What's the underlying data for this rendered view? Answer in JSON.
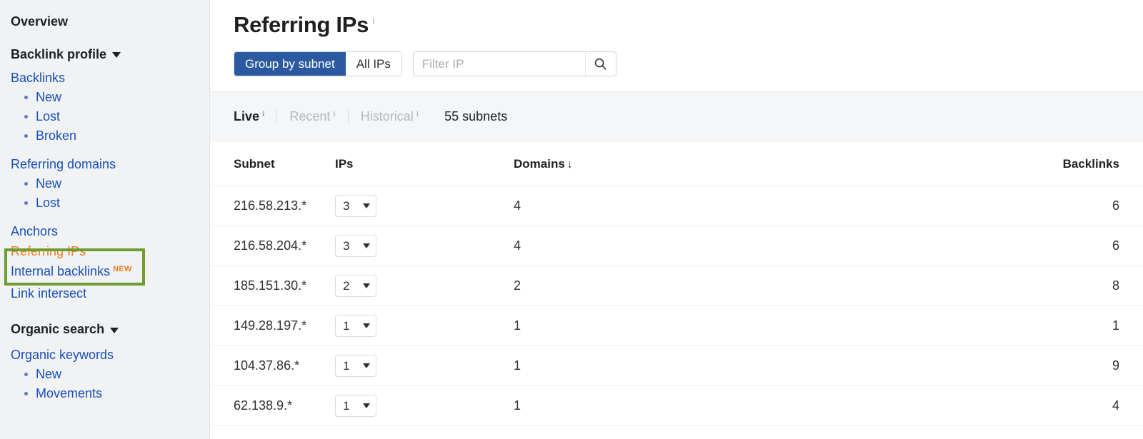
{
  "theme": {
    "accent_blue": "#2c5aa0",
    "link_blue": "#1a4fba",
    "active_orange": "#ef7d22",
    "highlight_green": "#6f9c2f",
    "sidebar_bg": "#f1f2f3",
    "strip_bg": "#f5f6f7"
  },
  "sidebar": {
    "overview_label": "Overview",
    "groups": [
      {
        "title": "Backlink profile",
        "caret": "chevron-down-icon",
        "items": [
          {
            "label": "Backlinks",
            "type": "link",
            "active": false
          },
          {
            "label": "New",
            "type": "sub",
            "active": false
          },
          {
            "label": "Lost",
            "type": "sub",
            "active": false
          },
          {
            "label": "Broken",
            "type": "sub",
            "active": false
          },
          {
            "label": "Referring domains",
            "type": "link",
            "active": false,
            "gap_before": true
          },
          {
            "label": "New",
            "type": "sub",
            "active": false
          },
          {
            "label": "Lost",
            "type": "sub",
            "active": false
          },
          {
            "label": "Anchors",
            "type": "link",
            "active": false,
            "gap_before": true
          },
          {
            "label": "Referring IPs",
            "type": "link",
            "active": true
          },
          {
            "label": "Internal backlinks",
            "type": "link",
            "active": false,
            "badge": "NEW"
          },
          {
            "label": "Link intersect",
            "type": "link",
            "active": false
          }
        ]
      },
      {
        "title": "Organic search",
        "caret": "chevron-down-icon",
        "items": [
          {
            "label": "Organic keywords",
            "type": "link",
            "active": false
          },
          {
            "label": "New",
            "type": "sub",
            "active": false
          },
          {
            "label": "Movements",
            "type": "sub",
            "active": false
          }
        ]
      }
    ]
  },
  "main": {
    "title": "Referring IPs",
    "title_info": "i",
    "toolbar": {
      "group_by_subnet_label": "Group by subnet",
      "all_ips_label": "All IPs",
      "filter_value": "",
      "filter_placeholder": "Filter IP",
      "search_icon": "search-icon"
    },
    "strip": {
      "tabs": [
        {
          "label": "Live",
          "info": "i",
          "active": true
        },
        {
          "label": "Recent",
          "info": "i",
          "active": false
        },
        {
          "label": "Historical",
          "info": "i",
          "active": false
        }
      ],
      "count_label": "55 subnets"
    },
    "table": {
      "columns": [
        {
          "key": "subnet",
          "label": "Subnet",
          "sorted": false
        },
        {
          "key": "ips",
          "label": "IPs",
          "sorted": false
        },
        {
          "key": "domains",
          "label": "Domains",
          "sorted": true,
          "sort_arrow": "↓"
        },
        {
          "key": "backlinks",
          "label": "Backlinks",
          "sorted": false
        }
      ],
      "rows": [
        {
          "subnet": "216.58.213.*",
          "ips": "3",
          "domains": "4",
          "backlinks": "6"
        },
        {
          "subnet": "216.58.204.*",
          "ips": "3",
          "domains": "4",
          "backlinks": "6"
        },
        {
          "subnet": "185.151.30.*",
          "ips": "2",
          "domains": "2",
          "backlinks": "8"
        },
        {
          "subnet": "149.28.197.*",
          "ips": "1",
          "domains": "1",
          "backlinks": "1"
        },
        {
          "subnet": "104.37.86.*",
          "ips": "1",
          "domains": "1",
          "backlinks": "9"
        },
        {
          "subnet": "62.138.9.*",
          "ips": "1",
          "domains": "1",
          "backlinks": "4"
        }
      ]
    }
  }
}
